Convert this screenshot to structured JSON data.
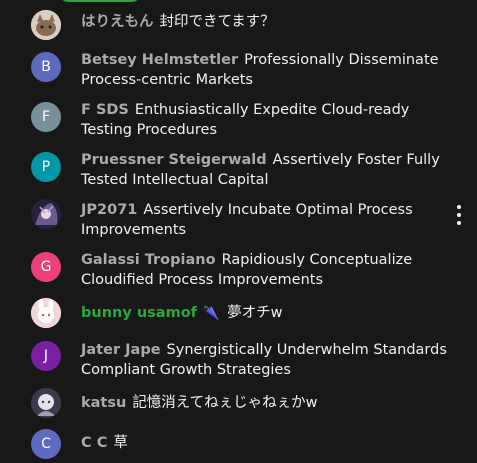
{
  "messages": [
    {
      "author": "はりえもん",
      "text": "封印できてます？",
      "avatar": "photo",
      "avatar_color": "#d8cfc2",
      "member": false
    },
    {
      "author": "Betsey Helmstetler",
      "text": "Professionally Disseminate Process-centric Markets",
      "avatar": "B",
      "avatar_color": "#5c6bc0",
      "member": false
    },
    {
      "author": "F SDS",
      "text": "Enthusiastically Expedite Cloud-ready Testing Procedures",
      "avatar": "F",
      "avatar_color": "#78909c",
      "member": false
    },
    {
      "author": "Pruessner Steigerwald",
      "text": "Assertively Foster Fully Tested Intellectual Capital",
      "avatar": "P",
      "avatar_color": "#0097a7",
      "member": false
    },
    {
      "author": "JP2071",
      "text": "Assertively Incubate Optimal Process Improvements",
      "avatar": "photo",
      "avatar_color": "#2a1f3d",
      "member": false
    },
    {
      "author": "Galassi Tropiano",
      "text": "Rapidiously Conceptualize Cloudified Process Improvements",
      "avatar": "G",
      "avatar_color": "#ec407a",
      "member": false
    },
    {
      "author": "bunny usamof",
      "text": "夢オチw",
      "avatar": "photo",
      "avatar_color": "#f3d6da",
      "member": true,
      "badge": "🌂"
    },
    {
      "author": "Jater Jape",
      "text": "Synergistically Underwhelm Standards Compliant Growth Strategies",
      "avatar": "J",
      "avatar_color": "#7b1fa2",
      "member": false
    },
    {
      "author": "katsu",
      "text": "記憶消えてねぇじゃねぇかw",
      "avatar": "photo",
      "avatar_color": "#3a3a4a",
      "member": false
    },
    {
      "author": "C C",
      "text": "草",
      "avatar": "C",
      "avatar_color": "#5c6bc0",
      "member": false
    }
  ]
}
